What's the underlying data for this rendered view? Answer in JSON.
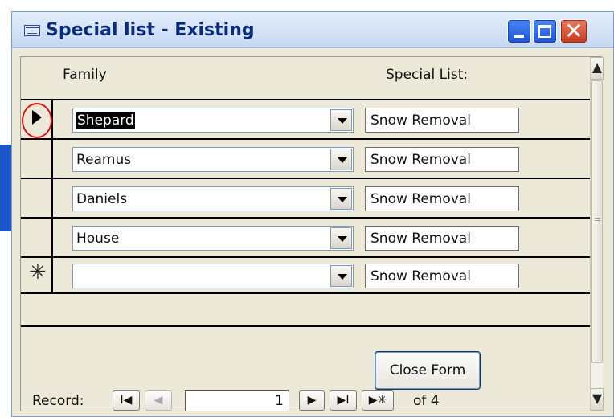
{
  "window": {
    "title": "Special list - Existing",
    "close_glyph": "✕"
  },
  "header": {
    "family_label": "Family",
    "special_label": "Special List:"
  },
  "rows": [
    {
      "family": "Shepard",
      "special": "Snow Removal"
    },
    {
      "family": "Reamus",
      "special": "Snow Removal"
    },
    {
      "family": "Daniels",
      "special": "Snow Removal"
    },
    {
      "family": "House",
      "special": "Snow Removal"
    }
  ],
  "new_row": {
    "family": "",
    "special": "Snow Removal",
    "marker": "✳"
  },
  "scroll": {
    "up": "▲",
    "down": "▼"
  },
  "buttons": {
    "close_form": "Close Form"
  },
  "nav": {
    "label": "Record:",
    "first": "I◀",
    "prev": "◀",
    "current": "1",
    "next": "▶",
    "last": "▶I",
    "new": "▶✳",
    "of_text": "of 4"
  },
  "colors": {
    "title_text": "#0b2c7b",
    "close_accent": "#c8381e",
    "selection_circle": "#e01010"
  },
  "icons": [
    "form-icon",
    "minimize-icon",
    "maximize-icon",
    "close-icon",
    "record-selector-arrow-icon",
    "new-record-star-icon",
    "dropdown-arrow-icon"
  ]
}
